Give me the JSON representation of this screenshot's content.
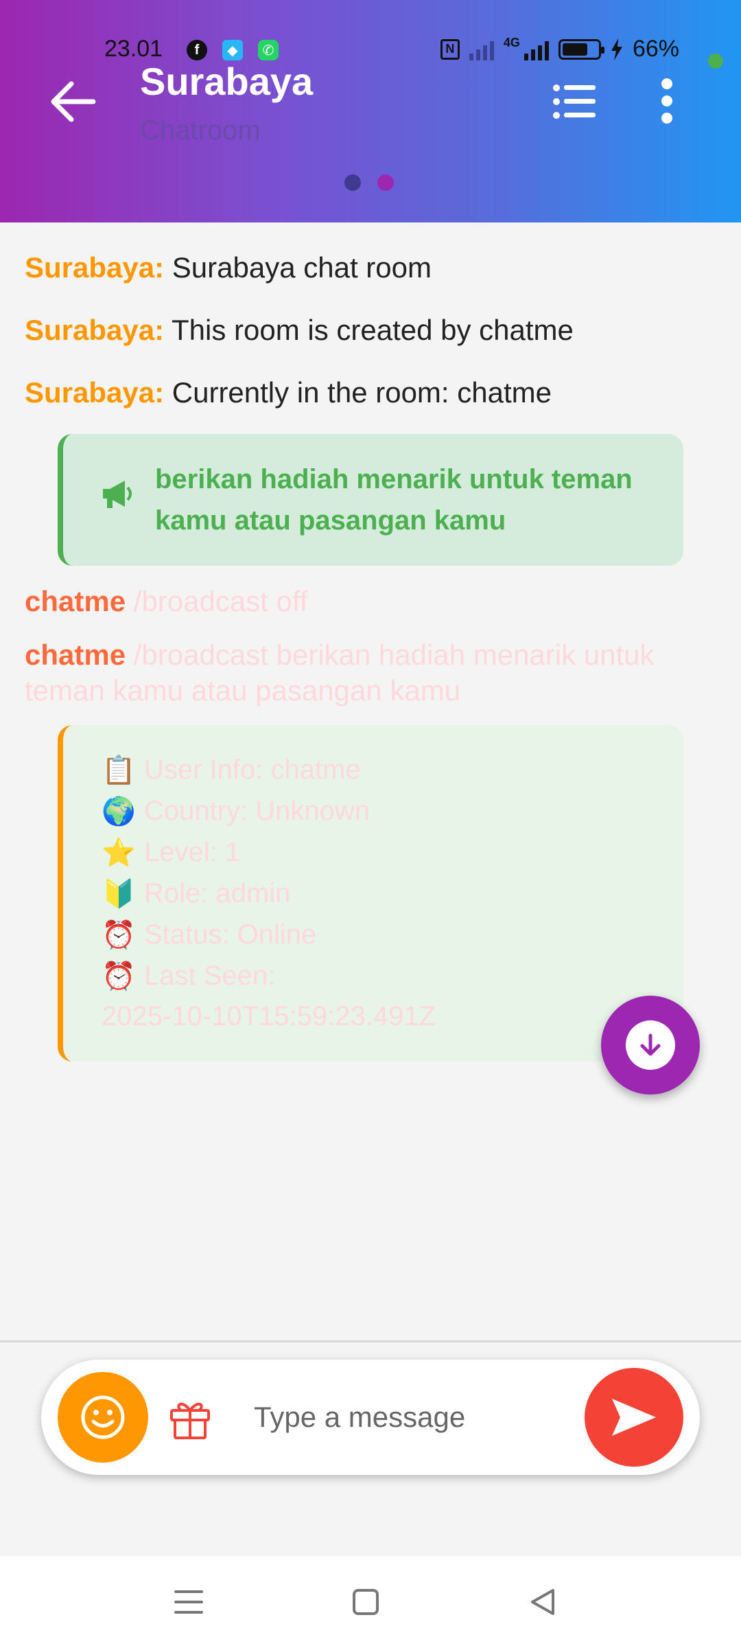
{
  "status_bar": {
    "time": "23.01",
    "battery": "66%",
    "network": "4G",
    "icons": [
      "facebook-icon",
      "game-app-icon",
      "phone-icon",
      "nfc-icon",
      "signal-icon",
      "battery-icon",
      "charging-icon"
    ]
  },
  "header": {
    "title": "Surabaya",
    "subtitle": "Chatroom",
    "page_indicator": {
      "count": 2,
      "active": 2
    },
    "colors": {
      "gradient_start": "#9c27b0",
      "gradient_end": "#2196f3"
    }
  },
  "messages": [
    {
      "sender": "Surabaya:",
      "text": " Surabaya chat room"
    },
    {
      "sender": "Surabaya:",
      "text": " This room is created by chatme"
    },
    {
      "sender": "Surabaya:",
      "text": " Currently in the room: chatme"
    }
  ],
  "broadcast": {
    "text": "berikan hadiah menarik untuk teman kamu atau pasangan kamu",
    "icon": "megaphone-icon",
    "color": "#4caf50"
  },
  "user_commands": [
    {
      "sender": "chatme",
      "text": " /broadcast off"
    },
    {
      "sender": "chatme",
      "text": " /broadcast berikan hadiah menarik untuk teman kamu atau pasangan kamu"
    }
  ],
  "user_info": {
    "rows": [
      {
        "emoji": "📋",
        "text": "User Info: chatme"
      },
      {
        "emoji": "🌍",
        "text": "Country: Unknown"
      },
      {
        "emoji": "⭐",
        "text": "Level: 1"
      },
      {
        "emoji": "🔰",
        "text": "Role: admin"
      },
      {
        "emoji": "⏰",
        "text": "Status: Online"
      },
      {
        "emoji": "⏰",
        "text": "Last Seen:"
      }
    ],
    "last_seen_date": "2025-10-10T15:59:23.491Z"
  },
  "input": {
    "placeholder": "Type a message",
    "value": ""
  },
  "colors": {
    "accent_orange": "#ff9800",
    "send_red": "#f44336",
    "fab_purple": "#9c27b0"
  }
}
